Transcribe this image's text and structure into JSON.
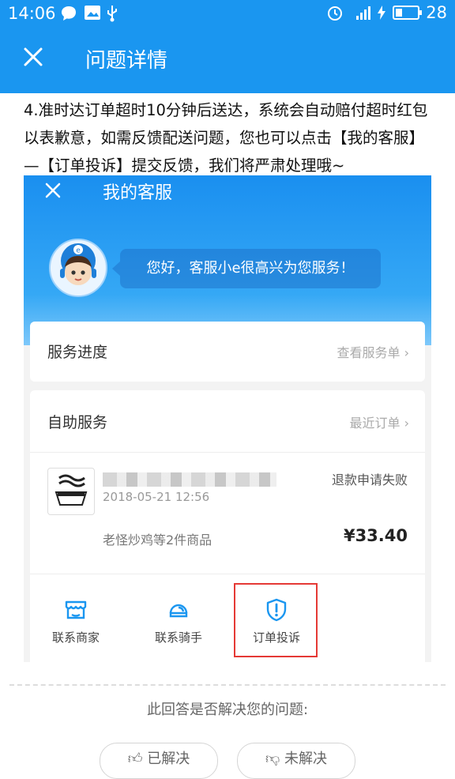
{
  "status_bar": {
    "time": "14:06",
    "battery_level": "28"
  },
  "header": {
    "title": "问题详情"
  },
  "article": {
    "text": "4.准时达订单超时10分钟后送达，系统会自动赔付超时红包以表歉意，如需反馈配送问题，您也可以点击【我的客服】—【订单投诉】提交反馈，我们将严肃处理哦~"
  },
  "embedded_screenshot": {
    "title": "我的客服",
    "greeting": "您好，客服小e很高兴为您服务！",
    "service_progress": {
      "label": "服务进度",
      "link": "查看服务单"
    },
    "self_service": {
      "label": "自助服务",
      "link": "最近订单",
      "order": {
        "datetime": "2018-05-21 12:56",
        "status": "退款申请失败",
        "items": "老怪炒鸡等2件商品",
        "price": "¥33.40"
      },
      "actions": [
        {
          "label": "联系商家",
          "icon": "store-icon"
        },
        {
          "label": "联系骑手",
          "icon": "rider-icon"
        },
        {
          "label": "订单投诉",
          "icon": "complaint-icon"
        }
      ]
    }
  },
  "feedback": {
    "question": "此回答是否解决您的问题:",
    "solved": "已解决",
    "unsolved": "未解决"
  },
  "colors": {
    "brand_blue": "#1a96f0",
    "highlight_red": "#e53935"
  }
}
